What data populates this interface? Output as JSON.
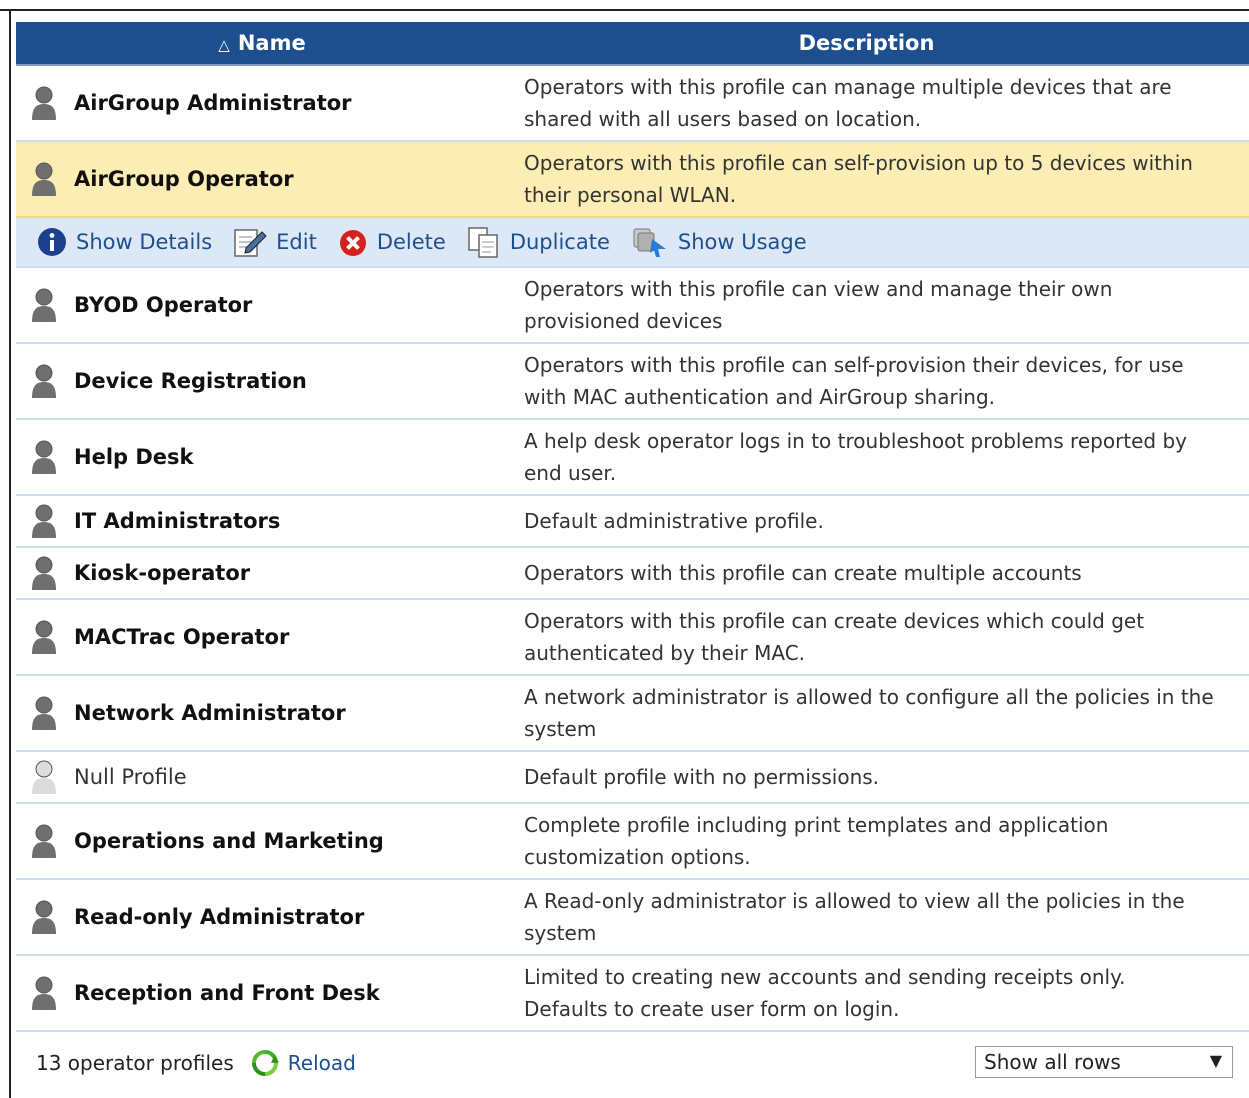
{
  "header": {
    "name": "Name",
    "description": "Description",
    "sort_indicator": "sort-ascending-icon"
  },
  "rows": [
    {
      "name": "AirGroup Administrator",
      "desc1": "Operators with this profile can manage multiple devices that are",
      "desc2": "shared with all users based on location."
    },
    {
      "name": "AirGroup Operator",
      "desc1": "Operators with this profile can self-provision up to 5 devices within",
      "desc2": "their personal WLAN."
    },
    {
      "name": "BYOD Operator",
      "desc1": "Operators with this profile can view and manage their own",
      "desc2": "provisioned devices"
    },
    {
      "name": "Device Registration",
      "desc1": "Operators with this profile can self-provision their devices, for use",
      "desc2": "with MAC authentication and AirGroup sharing."
    },
    {
      "name": "Help Desk",
      "desc1": "A help desk operator logs in to troubleshoot problems reported by",
      "desc2": "end user."
    },
    {
      "name": "IT Administrators",
      "desc1": "Default administrative profile.",
      "desc2": ""
    },
    {
      "name": "Kiosk-operator",
      "desc1": "Operators with this profile can create multiple accounts",
      "desc2": ""
    },
    {
      "name": "MACTrac Operator",
      "desc1": "Operators with this profile can create devices which could get",
      "desc2": "authenticated by their MAC."
    },
    {
      "name": "Network Administrator",
      "desc1": "A network administrator is allowed to configure all the policies in the",
      "desc2": "system"
    },
    {
      "name": "Null Profile",
      "desc1": "Default profile with no permissions.",
      "desc2": ""
    },
    {
      "name": "Operations and Marketing",
      "desc1": "Complete profile including print templates and application",
      "desc2": "customization options."
    },
    {
      "name": "Read-only Administrator",
      "desc1": "A Read-only administrator is allowed to view all the policies in the",
      "desc2": "system"
    },
    {
      "name": "Reception and Front Desk",
      "desc1": "Limited to creating new accounts and sending receipts only.",
      "desc2": "Defaults to create user form on login."
    }
  ],
  "actions": {
    "show_details": "Show Details",
    "edit": "Edit",
    "delete": "Delete",
    "duplicate": "Duplicate",
    "show_usage": "Show Usage"
  },
  "footer": {
    "count": "13 operator profiles",
    "reload": "Reload",
    "rows_select": "Show all rows"
  },
  "colors": {
    "header_bg": "#1d4f8f",
    "selected_row": "#fcedb5",
    "action_bar": "#dce8f6",
    "link": "#1d4f8f"
  }
}
